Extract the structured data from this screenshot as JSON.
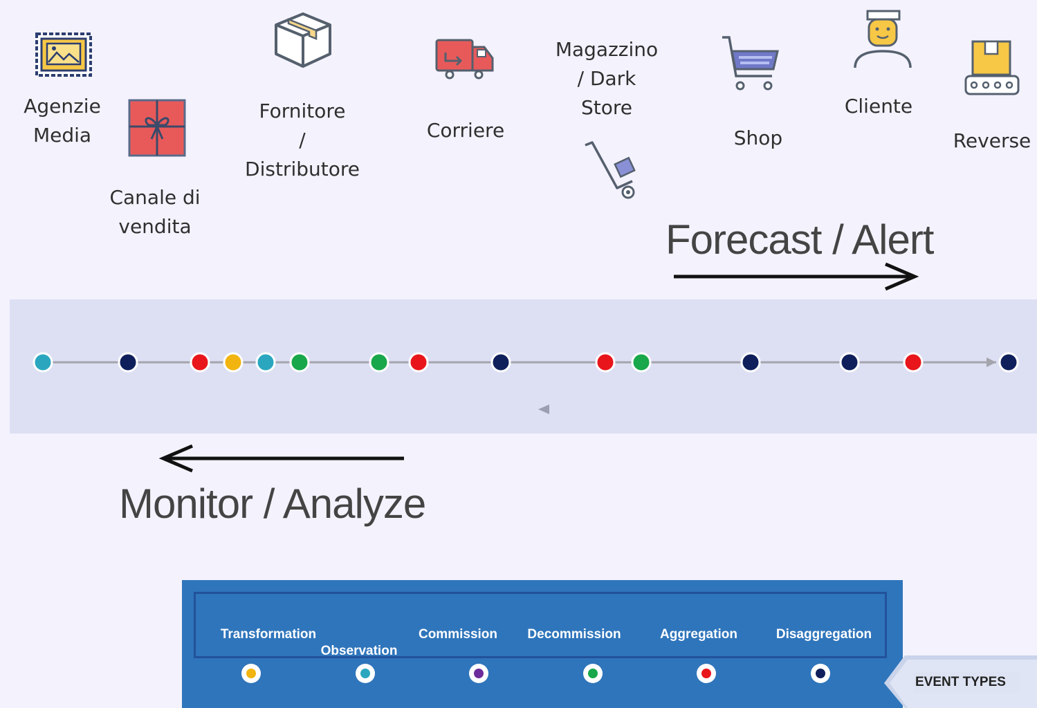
{
  "actors": [
    {
      "id": "agenzie-media",
      "label": "Agenzie\nMedia",
      "icon": "picture-stamp-icon"
    },
    {
      "id": "canale-di-vendita",
      "label": "Canale di\nvendita",
      "icon": "gift-box-icon"
    },
    {
      "id": "fornitore",
      "label": "Fornitore\n/\nDistributore",
      "icon": "package-box-icon"
    },
    {
      "id": "corriere",
      "label": "Corriere",
      "icon": "delivery-truck-icon"
    },
    {
      "id": "magazzino",
      "label": "Magazzino\n/ Dark\nStore",
      "icon": "hand-truck-icon"
    },
    {
      "id": "shop",
      "label": "Shop",
      "icon": "shopping-cart-icon"
    },
    {
      "id": "cliente",
      "label": "Cliente",
      "icon": "customer-person-icon"
    },
    {
      "id": "reverse",
      "label": "Reverse",
      "icon": "conveyor-box-icon"
    }
  ],
  "forecast_label": "Forecast / Alert",
  "monitor_label": "Monitor / Analyze",
  "timeline": {
    "events": [
      {
        "color": "#2aa7bf"
      },
      {
        "color": "#0f1f5c"
      },
      {
        "color": "#e8161b"
      },
      {
        "color": "#f2b40f"
      },
      {
        "color": "#2aa7bf"
      },
      {
        "color": "#18a74a"
      },
      {
        "color": "#18a74a"
      },
      {
        "color": "#e8161b"
      },
      {
        "color": "#0f1f5c"
      },
      {
        "color": "#e8161b"
      },
      {
        "color": "#18a74a"
      },
      {
        "color": "#0f1f5c"
      },
      {
        "color": "#0f1f5c"
      },
      {
        "color": "#e8161b"
      },
      {
        "color": "#0f1f5c"
      }
    ]
  },
  "legend": {
    "title": "EVENT TYPES",
    "items": [
      {
        "label": "Transformation",
        "color": "#f2b40f"
      },
      {
        "label": "Observation",
        "color": "#2aa7bf"
      },
      {
        "label": "Commission",
        "color": "#6c2c9c"
      },
      {
        "label": "Decommission",
        "color": "#18a74a"
      },
      {
        "label": "Aggregation",
        "color": "#e8161b"
      },
      {
        "label": "Disaggregation",
        "color": "#0f1f5c"
      }
    ]
  },
  "colors": {
    "panel": "#2f75bb",
    "band": "#dde0f3",
    "background": "#f4f2fd"
  }
}
